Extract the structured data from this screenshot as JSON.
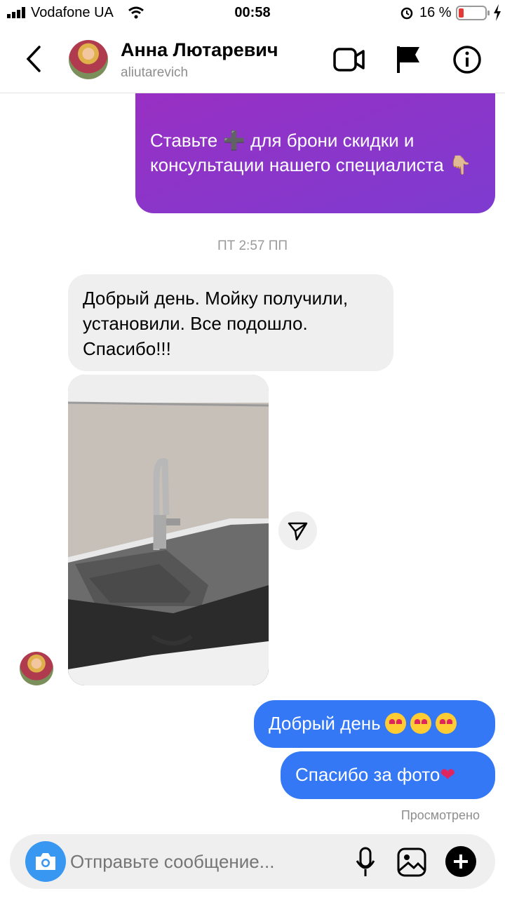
{
  "status_bar": {
    "carrier": "Vodafone UA",
    "time": "00:58",
    "battery": "16 %"
  },
  "header": {
    "name": "Анна Лютаревич",
    "username": "aliutarevich"
  },
  "messages": {
    "outgoing_promo_text": "Ставьте ➕ для брони скидки и консультации нашего специалиста 👇🏼",
    "timestamp": "ПТ 2:57 ПП",
    "incoming_text": "Добрый день. Мойку получили, установили. Все подошло. Спасибо!!!",
    "reply_1": "Добрый день",
    "reply_2": "Спасибо за фото",
    "reply_2_emoji": "❤",
    "seen_label": "Просмотрено"
  },
  "composer": {
    "placeholder": "Отправьте сообщение..."
  },
  "icons": [
    "back-arrow-icon",
    "video-call-icon",
    "flag-icon",
    "info-icon",
    "send-icon",
    "camera-icon",
    "microphone-icon",
    "gallery-icon",
    "plus-icon"
  ]
}
